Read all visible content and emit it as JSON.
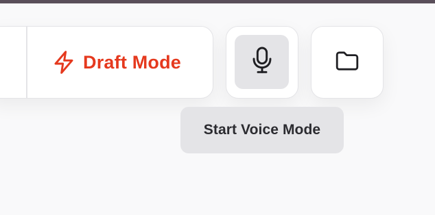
{
  "toolbar": {
    "draft_mode_label": "Draft Mode",
    "draft_mode_icon": "lightning-bolt-icon",
    "accent_color": "#e5391e"
  },
  "voice": {
    "icon": "microphone-icon",
    "tooltip": "Start Voice Mode"
  },
  "folder": {
    "icon": "folder-icon"
  }
}
